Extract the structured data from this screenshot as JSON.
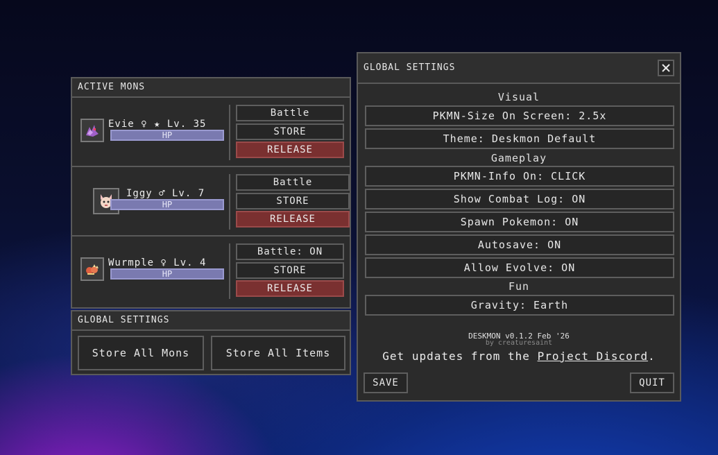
{
  "active_panel": {
    "title": "ACTIVE MONS",
    "mons": [
      {
        "name": "Evie ♀ ★ Lv. 35",
        "hp_label": "HP",
        "battle_label": "Battle",
        "store_label": "STORE",
        "release_label": "RELEASE"
      },
      {
        "name": "Iggy ♂ Lv. 7",
        "hp_label": "HP",
        "battle_label": "Battle",
        "store_label": "STORE",
        "release_label": "RELEASE"
      },
      {
        "name": "Wurmple ♀ Lv. 4",
        "hp_label": "HP",
        "battle_label": "Battle: ON",
        "store_label": "STORE",
        "release_label": "RELEASE"
      }
    ]
  },
  "global_small": {
    "title": "GLOBAL SETTINGS",
    "store_all_mons": "Store All Mons",
    "store_all_items": "Store All Items"
  },
  "settings": {
    "title": "GLOBAL SETTINGS",
    "close_icon": "close-icon",
    "visual_title": "Visual",
    "pkmn_size": "PKMN-Size On Screen: 2.5x",
    "theme": "Theme: Deskmon Default",
    "gameplay_title": "Gameplay",
    "pkmn_info": "PKMN-Info On: CLICK",
    "combat_log": "Show Combat Log: ON",
    "spawn": "Spawn Pokemon: ON",
    "autosave": "Autosave: ON",
    "evolve": "Allow Evolve: ON",
    "fun_title": "Fun",
    "gravity": "Gravity: Earth",
    "version": "DESKMON v0.1.2 Feb '26",
    "byline": "by creaturesaint",
    "updates_prefix": "Get updates from the ",
    "discord_link": "Project Discord",
    "updates_suffix": ".",
    "save_label": "SAVE",
    "quit_label": "QUIT"
  },
  "colors": {
    "panel_bg": "#2b2b2b",
    "border": "#5a5a5a",
    "release": "#7a3030",
    "hp": "#7a7ab0"
  }
}
